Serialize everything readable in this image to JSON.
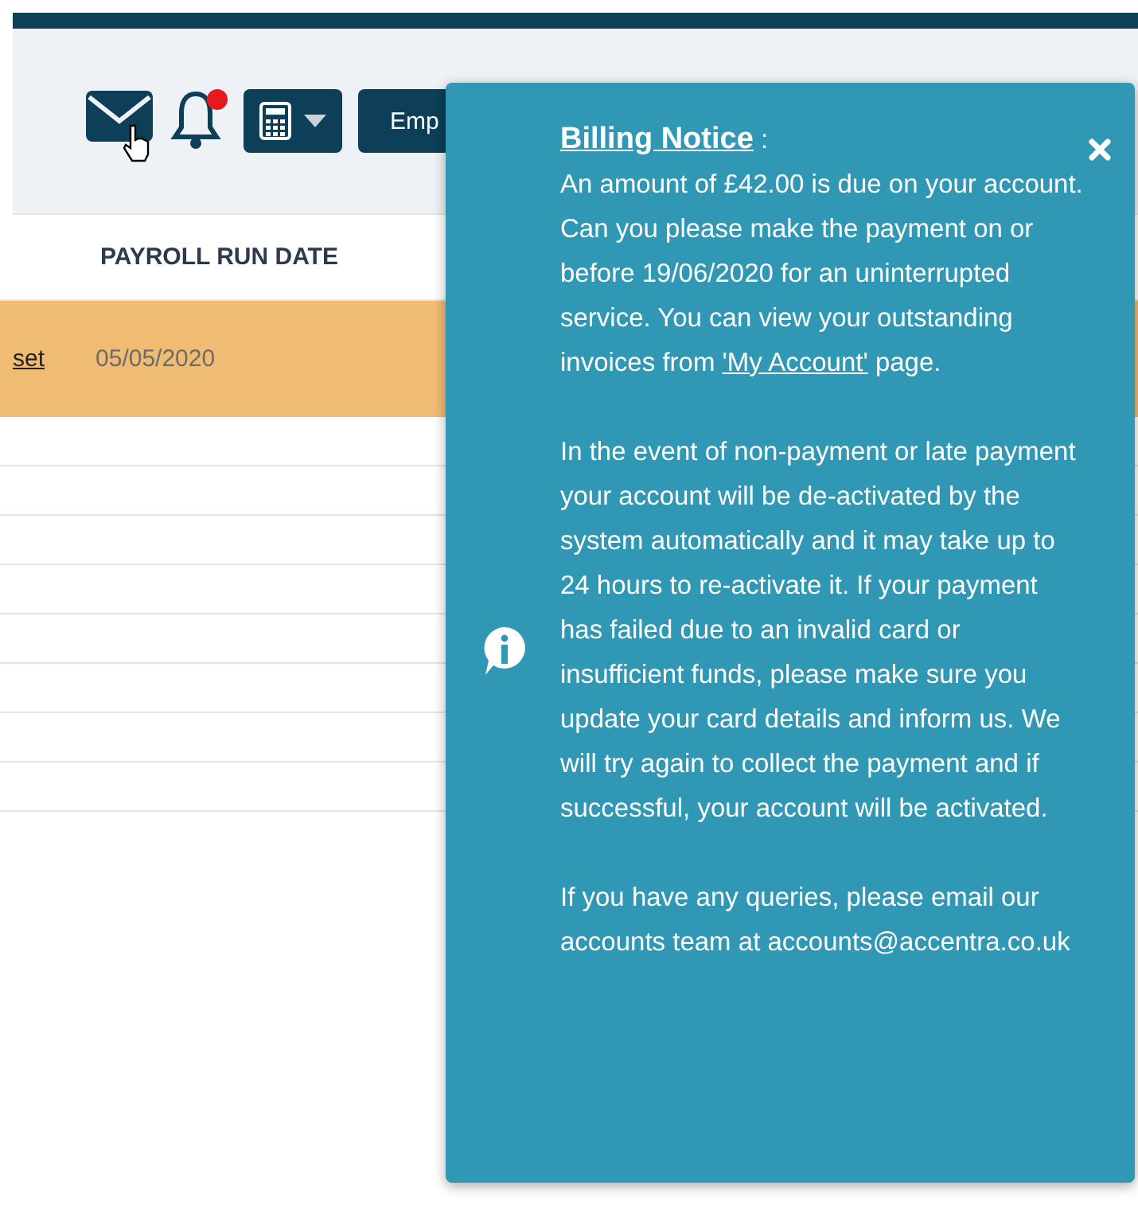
{
  "toolbar": {
    "notifications": {
      "unread": true
    },
    "buttons": [
      {
        "kind": "calculator-dropdown"
      },
      {
        "kind": "text",
        "label": "Emp"
      }
    ]
  },
  "table": {
    "columns": [
      "PAYROLL RUN DATE"
    ],
    "rows": [
      {
        "link": "set",
        "date": "05/05/2020",
        "highlighted": true
      }
    ]
  },
  "billing_notice": {
    "title": "Billing Notice",
    "title_suffix": " :",
    "paragraphs": [
      {
        "before": "An amount of £42.00 is due on your account. Can you please make the payment on or before 19/06/2020 for an uninterrupted service. You can view your outstanding invoices from ",
        "link": "'My Account'",
        "after": " page."
      },
      {
        "before": "In the event of non-payment or late payment your account will be de-activated by the system automatically and it may take up to 24 hours to re-activate it. If your payment has failed due to an invalid card or insufficient funds, please make sure you update your card details and inform us. We will try again to collect the payment and if successful, your account will be activated."
      },
      {
        "before": "If you have any queries, please email our accounts team at accounts@accentra.co.uk"
      }
    ]
  }
}
